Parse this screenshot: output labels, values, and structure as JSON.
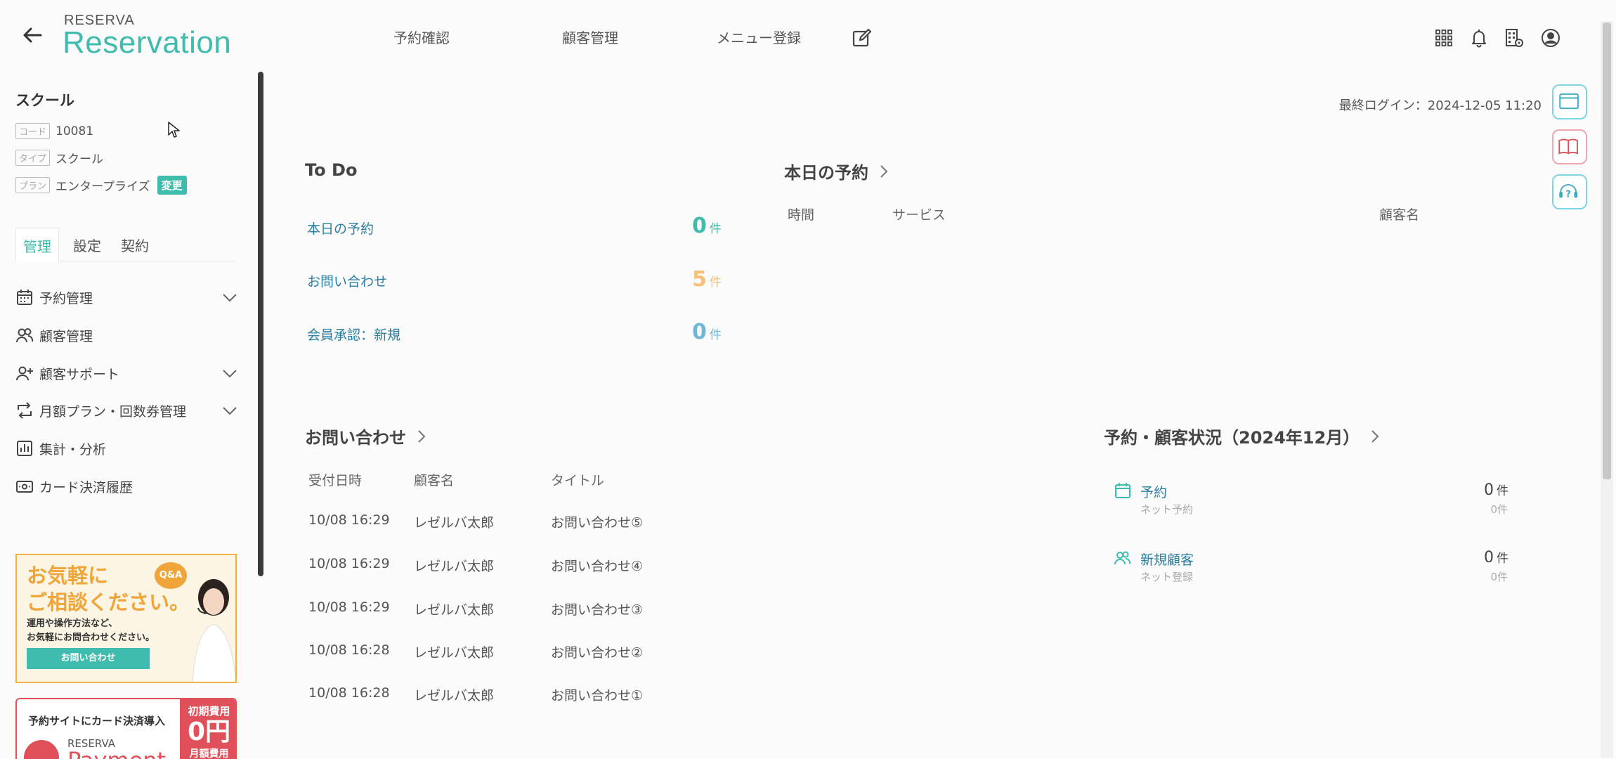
{
  "header": {
    "brand_small": "RESERVA",
    "brand_big": "Reservation",
    "nav": [
      {
        "label": "予約確認"
      },
      {
        "label": "顧客管理"
      },
      {
        "label": "メニュー登録"
      }
    ]
  },
  "sidebar": {
    "shop_name": "スクール",
    "meta": [
      {
        "tag": "コード",
        "value": "10081"
      },
      {
        "tag": "タイプ",
        "value": "スクール"
      },
      {
        "tag": "プラン",
        "value": "エンタープライズ"
      }
    ],
    "change_label": "変更",
    "tabs": [
      {
        "label": "管理"
      },
      {
        "label": "設定"
      },
      {
        "label": "契約"
      }
    ],
    "menu": [
      {
        "label": "予約管理",
        "icon": "calendar-icon"
      },
      {
        "label": "顧客管理",
        "icon": "users-icon"
      },
      {
        "label": "顧客サポート",
        "icon": "user-plus-icon"
      },
      {
        "label": "月額プラン・回数券管理",
        "icon": "repeat-icon"
      },
      {
        "label": "集計・分析",
        "icon": "bar-chart-icon"
      },
      {
        "label": "カード決済履歴",
        "icon": "card-icon"
      }
    ],
    "banner1": {
      "title_line1": "お気軽に",
      "title_line2": "ご相談ください。",
      "sub_line1": "運用や操作方法など、",
      "sub_line2": "お気軽にお問合わせください。",
      "button": "お問い合わせ",
      "qa": "Q&A"
    },
    "banner2": {
      "text": "予約サイトにカード決済導入",
      "logo_small": "RESERVA",
      "logo_big": "Payment",
      "badge_line1": "初期費用",
      "badge_line2": "0円",
      "badge_line3": "月額費用"
    }
  },
  "main": {
    "last_login": "最終ログイン：2024-12-05 11:20",
    "todo": {
      "title": "To Do",
      "items": [
        {
          "label": "本日の予約",
          "count": "0",
          "unit": "件",
          "color": "#3fbcae"
        },
        {
          "label": "お問い合わせ",
          "count": "5",
          "unit": "件",
          "color": "#f5c07a"
        },
        {
          "label": "会員承認：新規",
          "count": "0",
          "unit": "件",
          "color": "#6fb7d8"
        }
      ]
    },
    "today": {
      "title": "本日の予約",
      "columns": [
        "時間",
        "サービス",
        "顧客名"
      ]
    },
    "inquiries": {
      "title": "お問い合わせ",
      "columns": [
        "受付日時",
        "顧客名",
        "タイトル"
      ],
      "rows": [
        [
          "10/08 16:29",
          "レゼルバ太郎",
          "お問い合わせ⑤"
        ],
        [
          "10/08 16:29",
          "レゼルバ太郎",
          "お問い合わせ④"
        ],
        [
          "10/08 16:29",
          "レゼルバ太郎",
          "お問い合わせ③"
        ],
        [
          "10/08 16:28",
          "レゼルバ太郎",
          "お問い合わせ②"
        ],
        [
          "10/08 16:28",
          "レゼルバ太郎",
          "お問い合わせ①"
        ]
      ]
    },
    "status": {
      "title": "予約・顧客状況（2024年12月）",
      "items": [
        {
          "label": "予約",
          "sub": "ネット予約",
          "value": "0",
          "unit": "件",
          "subvalue": "0件"
        },
        {
          "label": "新規顧客",
          "sub": "ネット登録",
          "value": "0",
          "unit": "件",
          "subvalue": "0件"
        }
      ]
    }
  },
  "colors": {
    "accent": "#3fbcae",
    "link": "#2c7fa3",
    "orange": "#f0a53a",
    "red": "#e0505a"
  }
}
